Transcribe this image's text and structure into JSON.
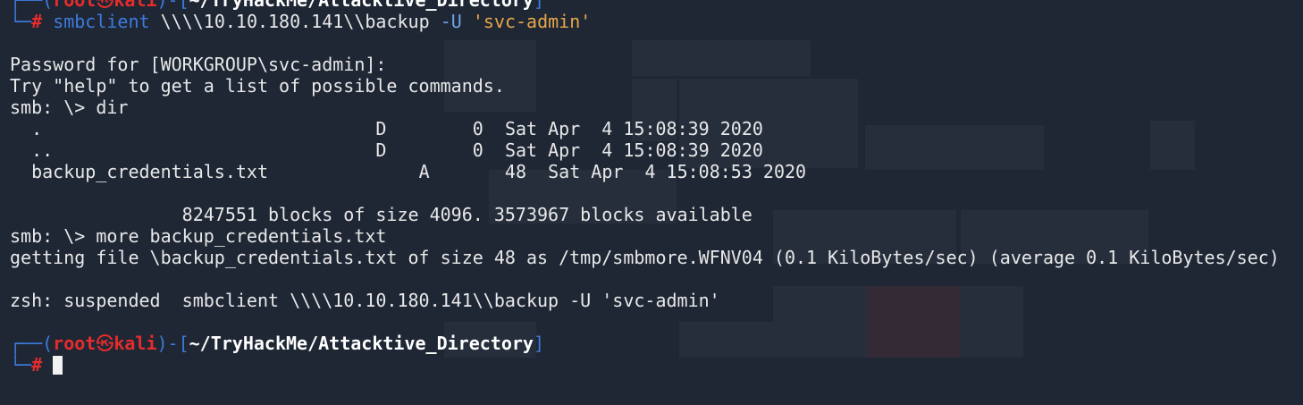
{
  "prompt": {
    "user": "root",
    "skull": "㉿",
    "host": "kali",
    "path": "~/TryHackMe/Attacktive_Directory",
    "symbol": "#"
  },
  "command": {
    "name": "smbclient",
    "target": "\\\\\\\\10.10.180.141\\\\backup",
    "flag": "-U",
    "user_arg": "'svc-admin'"
  },
  "output": {
    "password_prompt": "Password for [WORKGROUP\\svc-admin]:",
    "help_hint": "Try \"help\" to get a list of possible commands.",
    "smb_dir": "smb: \\> dir",
    "listing": [
      {
        "name": ".",
        "attr": "D",
        "size": "0",
        "date": "Sat Apr  4 15:08:39 2020"
      },
      {
        "name": "..",
        "attr": "D",
        "size": "0",
        "date": "Sat Apr  4 15:08:39 2020"
      },
      {
        "name": "backup_credentials.txt",
        "attr": "A",
        "size": "48",
        "date": "Sat Apr  4 15:08:53 2020"
      }
    ],
    "blocks": "                8247551 blocks of size 4096. 3573967 blocks available",
    "smb_more": "smb: \\> more backup_credentials.txt",
    "getting_file": "getting file \\backup_credentials.txt of size 48 as /tmp/smbmore.WFNV04 (0.1 KiloBytes/sec) (average 0.1 KiloBytes/sec)",
    "suspended": "zsh: suspended  smbclient \\\\\\\\10.10.180.141\\\\backup -U 'svc-admin'"
  }
}
